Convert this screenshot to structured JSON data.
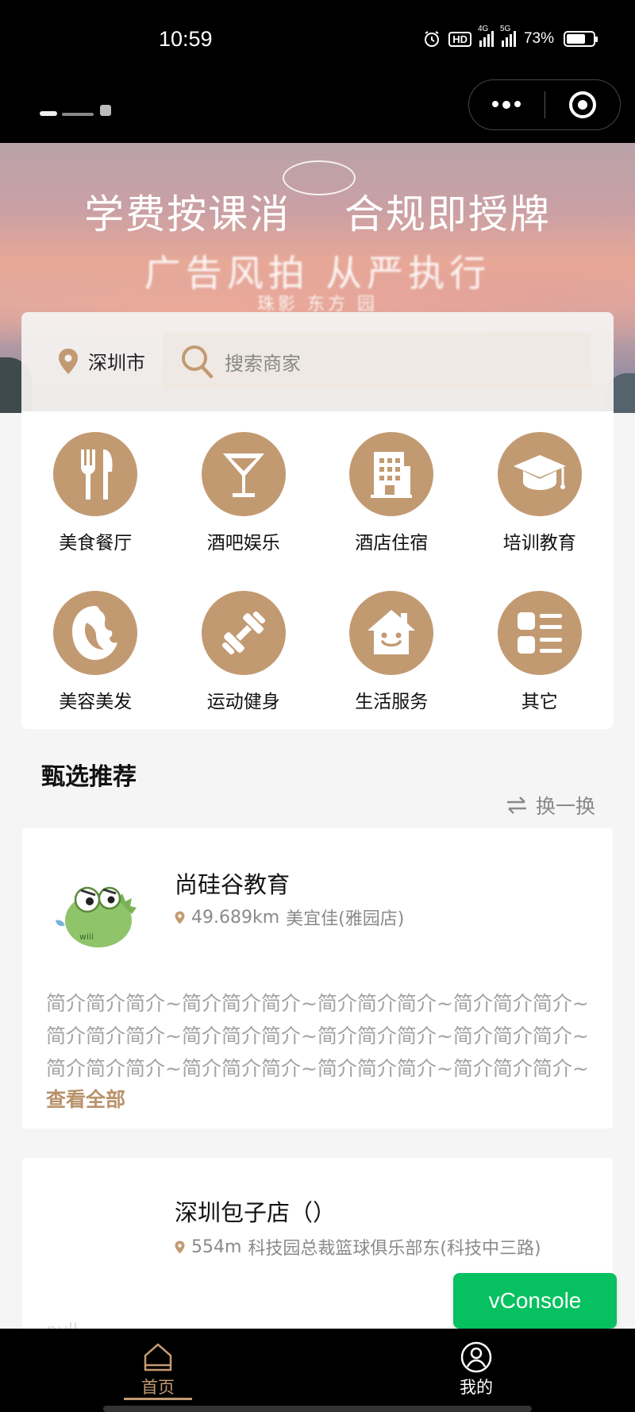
{
  "status_bar": {
    "time": "10:59",
    "hd_label": "HD",
    "net1": "4G",
    "net2": "5G",
    "battery": "73%",
    "battery_level": 0.73
  },
  "banner": {
    "line1": "学费按课消  合规即授牌",
    "line2": "广告风拍 从严执行",
    "line3": "珠影 东方 园"
  },
  "search": {
    "city": "深圳市",
    "placeholder": "搜索商家"
  },
  "categories": [
    {
      "label": "美食餐厅",
      "icon": "fork-knife-icon"
    },
    {
      "label": "酒吧娱乐",
      "icon": "cocktail-icon"
    },
    {
      "label": "酒店住宿",
      "icon": "building-icon"
    },
    {
      "label": "培训教育",
      "icon": "graduation-cap-icon"
    },
    {
      "label": "美容美发",
      "icon": "face-icon"
    },
    {
      "label": "运动健身",
      "icon": "dumbbell-icon"
    },
    {
      "label": "生活服务",
      "icon": "smiley-house-icon"
    },
    {
      "label": "其它",
      "icon": "list-icon"
    }
  ],
  "section": {
    "title": "甄选推荐",
    "refresh_label": "换一换"
  },
  "shops": [
    {
      "name": "尚硅谷教育",
      "distance": "49.689km",
      "address": "美宜佳(雅园店)",
      "intro": "简介简介简介~简介简介简介~简介简介简介~简介简介简介~简介简介简介~简介简介简介~简介简介简介~简介简介简介~简介简介简介~简介简介简介~简介简介简介~简介简介简介~",
      "more_label": "查看全部"
    },
    {
      "name": "深圳包子店（）",
      "distance": "554m",
      "address": "科技园总裁篮球俱乐部东(科技中三路)",
      "faded_text": "null"
    }
  ],
  "vconsole_label": "vConsole",
  "tabbar": {
    "home_label": "首页",
    "mine_label": "我的"
  },
  "colors": {
    "accent": "#c29a72",
    "vconsole": "#07c160"
  }
}
